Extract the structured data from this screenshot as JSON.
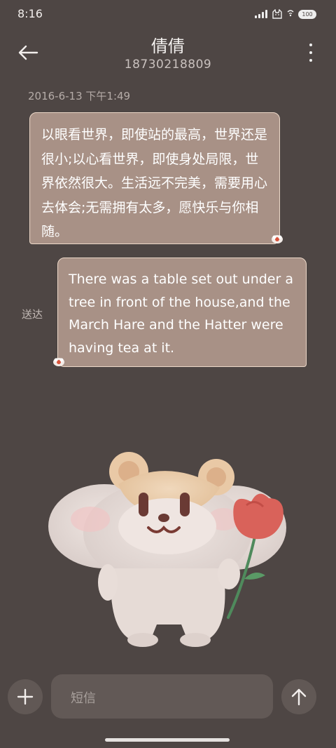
{
  "status_bar": {
    "time": "8:16",
    "battery": "100",
    "icons": [
      "signal-icon",
      "cat-icon",
      "wifi-icon",
      "battery-icon"
    ]
  },
  "header": {
    "back_icon": "arrow-left-icon",
    "contact_name": "倩倩",
    "phone_number": "18730218809",
    "more_icon": "more-vertical-icon"
  },
  "conversation": {
    "timestamp": "2016-6-13 下午1:49",
    "messages": [
      {
        "direction": "incoming",
        "text": "以眼看世界，即使站的最高，世界还是很小;以心看世界，即使身处局限，世界依然很大。生活远不完美，需要用心去体会;无需拥有太多，愿快乐与你相随。"
      },
      {
        "direction": "outgoing",
        "text": "There was a table set out under a tree in front of the house,and the March Hare and the Hatter were having tea at it.",
        "status": "送达"
      }
    ]
  },
  "composer": {
    "add_icon": "plus-icon",
    "placeholder": "短信",
    "send_icon": "arrow-up-icon"
  },
  "colors": {
    "background": "#4e4644",
    "bubble": "#a89186",
    "bubble_border": "#ecd8c8",
    "button": "#615855"
  }
}
